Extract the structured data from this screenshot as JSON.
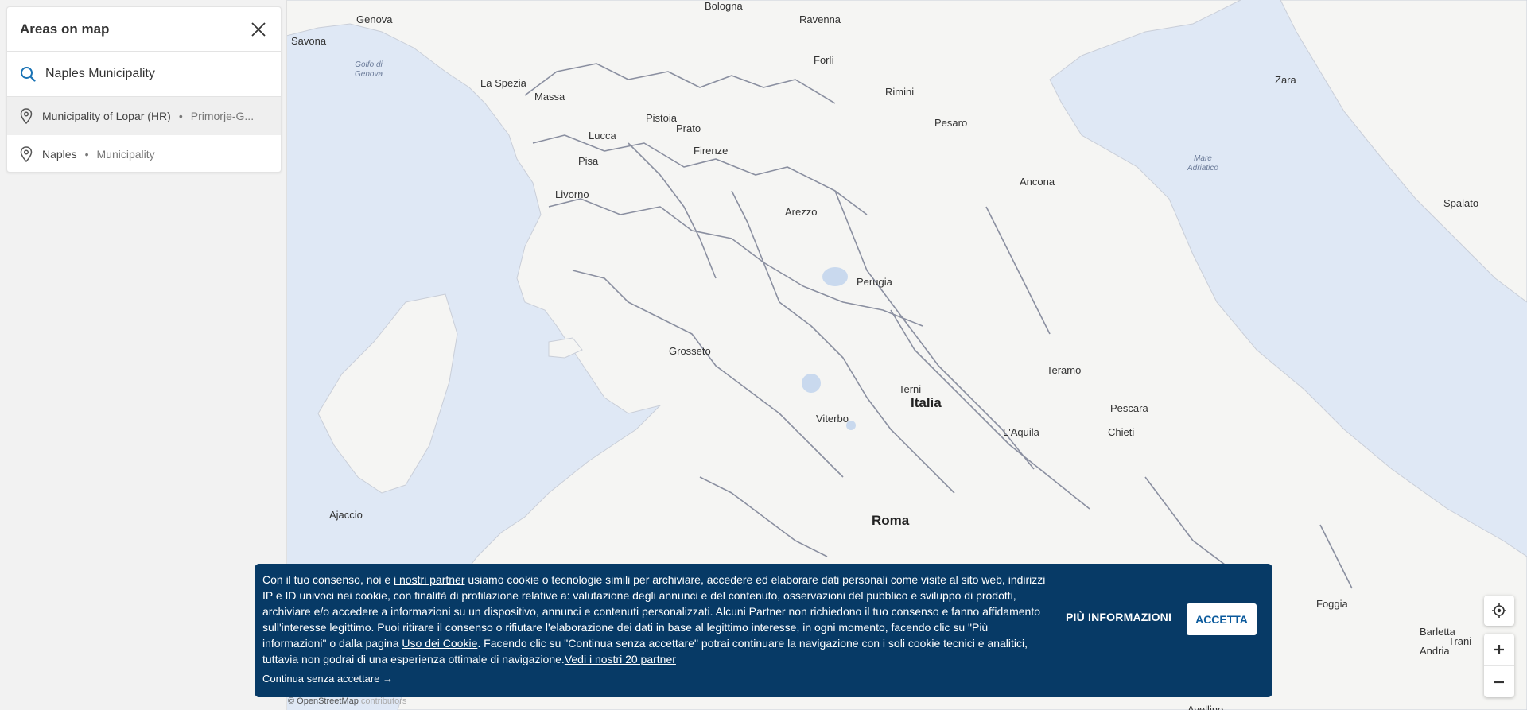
{
  "panel": {
    "title": "Areas on map",
    "search_value": "Naples Municipality",
    "results": [
      {
        "name": "Municipality of Lopar (HR)",
        "sub": "Primorje-G..."
      },
      {
        "name": "Naples",
        "sub": "Municipality"
      }
    ],
    "bullet": "•"
  },
  "map": {
    "labels": {
      "genova": "Genova",
      "savona": "Savona",
      "golfo": "Golfo di\nGenova",
      "la_spezia": "La Spezia",
      "massa": "Massa",
      "bologna": "Bologna",
      "ravenna": "Ravenna",
      "forli": "Forlì",
      "rimini": "Rimini",
      "pesaro": "Pesaro",
      "pistoia": "Pistoia",
      "prato": "Prato",
      "lucca": "Lucca",
      "firenze": "Firenze",
      "pisa": "Pisa",
      "livorno": "Livorno",
      "arezzo": "Arezzo",
      "ancona": "Ancona",
      "perugia": "Perugia",
      "grosseto": "Grosseto",
      "teramo": "Teramo",
      "terni": "Terni",
      "italia": "Italia",
      "pescara": "Pescara",
      "chieti": "Chieti",
      "viterbo": "Viterbo",
      "laquila": "L'Aquila",
      "roma": "Roma",
      "ajaccio": "Ajaccio",
      "zara": "Zara",
      "mare_adriatico": "Mare\nAdriatico",
      "spalato": "Spalato",
      "foggia": "Foggia",
      "barletta": "Barletta",
      "trani": "Trani",
      "andria": "Andria",
      "avellino": "Avellino"
    },
    "attribution": "© OpenStreetMap",
    "attribution_link": "contributors",
    "colors": {
      "sea": "#dfe8f5",
      "land": "#f5f5f3",
      "border": "#8a8fa0"
    }
  },
  "controls": {
    "locate_icon": "crosshair-icon",
    "zoom_in": "+",
    "zoom_out": "−"
  },
  "cookie": {
    "t1": "Con il tuo consenso, noi e ",
    "l1": "i nostri partner",
    "t2": " usiamo cookie o tecnologie simili per archiviare, accedere ed elaborare dati personali come visite al sito web, indirizzi IP e ID univoci nei cookie, con finalità di profilazione relative a: valutazione degli annunci e del contenuto, osservazioni del pubblico e sviluppo di prodotti, archiviare e/o accedere a informazioni su un dispositivo, annunci e contenuti personalizzati. Alcuni Partner non richiedono il tuo consenso e fanno affidamento sull'interesse legittimo. Puoi ritirare il consenso o rifiutare l'elaborazione dei dati in base al legittimo interesse, in ogni momento, facendo clic su \"Più informazioni\" o dalla pagina ",
    "l2": "Uso dei Cookie",
    "t3": ". Facendo clic su \"Continua senza accettare\" potrai continuare la navigazione con i soli cookie tecnici e analitici, tuttavia non godrai di una esperienza ottimale di navigazione.",
    "l3": "Vedi i nostri 20 partner",
    "continue": "Continua senza accettare →",
    "more": "PIÙ INFORMAZIONI",
    "accept": "ACCETTA",
    "bg": "#073a66"
  }
}
